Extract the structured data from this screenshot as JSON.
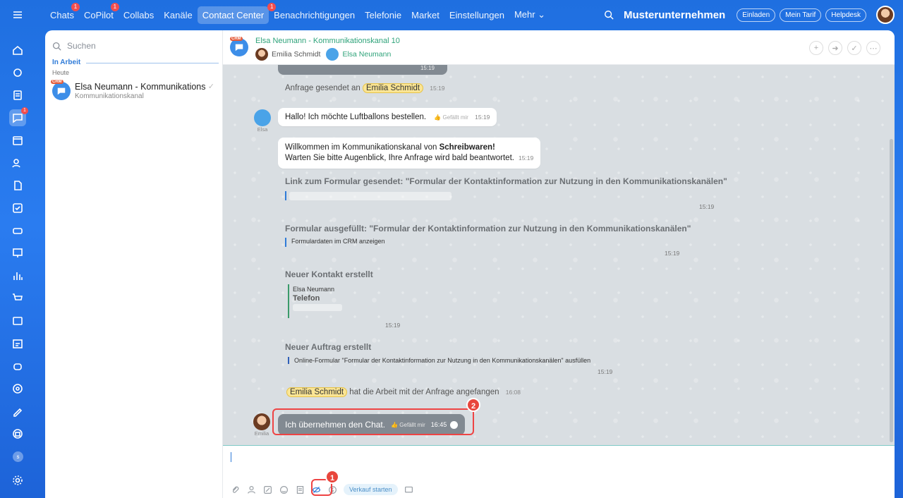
{
  "nav": {
    "items": [
      {
        "label": "Chats",
        "badge": "1"
      },
      {
        "label": "CoPilot",
        "badge": "1"
      },
      {
        "label": "Collabs",
        "badge": ""
      },
      {
        "label": "Kanäle",
        "badge": ""
      },
      {
        "label": "Contact Center",
        "badge": "",
        "active": true
      },
      {
        "label": "Benachrichtigungen",
        "badge": "1"
      },
      {
        "label": "Telefonie",
        "badge": ""
      },
      {
        "label": "Market",
        "badge": ""
      },
      {
        "label": "Einstellungen",
        "badge": ""
      },
      {
        "label": "Mehr ⌄",
        "badge": ""
      }
    ],
    "company": "Musterunternehmen",
    "invite": "Einladen",
    "tariff": "Mein Tarif",
    "helpdesk": "Helpdesk"
  },
  "rail": {
    "chat_badge": "1",
    "user_initial": "s"
  },
  "sidebar": {
    "search_placeholder": "Suchen",
    "section": "In Arbeit",
    "subsection": "Heute",
    "conversation": {
      "crm": "CRM",
      "title": "Elsa Neumann - Kommunikationsk...",
      "subtitle": "Kommunikationskanal"
    }
  },
  "chat": {
    "crm": "CRM",
    "title": "Elsa Neumann - Kommunikationskanal 10",
    "user1": "Emilia Schmidt",
    "user2": "Elsa Neumann",
    "msg_prev_time": "15:19",
    "sent_prefix": "Anfrage gesendet an",
    "sent_name": "Emilia Schmidt",
    "sent_time": "15:19",
    "elsa_msg": "Hallo! Ich möchte Luftballons bestellen.",
    "like": "Gefällt mir",
    "elsa_time": "15:19",
    "elsa_name": "Elsa",
    "welcome_a": "Willkommen im Kommunikationskanal von ",
    "welcome_b": "Schreibwaren!",
    "welcome_line2": "Warten Sie bitte Augenblick, Ihre Anfrage wird bald beantwortet.",
    "welcome_time": "15:19",
    "link_title": "Link zum Formular gesendet: \"Formular der Kontaktinformation zur Nutzung in den Kommunikationskanälen\"",
    "link_time": "15:19",
    "form_title": "Formular ausgefüllt: \"Formular der Kontaktinformation zur Nutzung in den Kommunikationskanälen\"",
    "form_link": "Formulardaten im CRM anzeigen",
    "form_time": "15:19",
    "contact_title": "Neuer Kontakt erstellt",
    "contact_name": "Elsa Neumann",
    "contact_phone": "Telefon",
    "contact_time": "15:19",
    "order_title": "Neuer Auftrag erstellt",
    "order_text": "Online-Formular \"Formular der Kontaktinformation zur Nutzung in den Kommunikationskanälen\" ausfüllen",
    "order_time": "15:19",
    "started_name": "Emilia Schmidt",
    "started_text": "hat die Arbeit mit der Anfrage angefangen",
    "started_time": "16:08",
    "own_msg": "Ich übernehmen den Chat.",
    "own_time": "16:45",
    "own_name": "Emilia",
    "marker1": "1",
    "marker2": "2"
  },
  "composer": {
    "sale_button": "Verkauf starten"
  }
}
